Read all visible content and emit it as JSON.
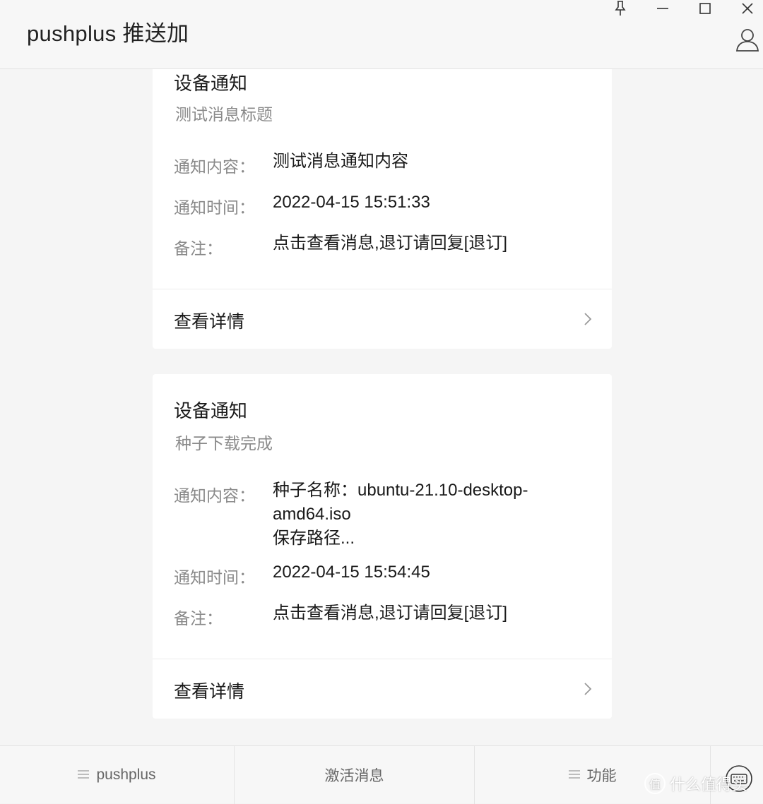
{
  "window": {
    "title": "pushplus 推送加",
    "icons": {
      "pin": "pin-icon",
      "minimize": "minimize-icon",
      "maximize": "maximize-icon",
      "close": "close-icon",
      "user": "user-icon"
    }
  },
  "cards": [
    {
      "title": "设备通知",
      "subtitle": "测试消息标题",
      "rows": [
        {
          "label": "通知内容：",
          "value": "测试消息通知内容"
        },
        {
          "label": "通知时间：",
          "value": "2022-04-15 15:51:33"
        },
        {
          "label": "备注：",
          "value": "点击查看消息,退订请回复[退订]"
        }
      ],
      "detail_label": "查看详情"
    },
    {
      "title": "设备通知",
      "subtitle": "种子下载完成",
      "rows": [
        {
          "label": "通知内容：",
          "value_lines": [
            "种子名称：ubuntu-21.10-desktop-",
            "amd64.iso",
            "保存路径..."
          ]
        },
        {
          "label": "通知时间：",
          "value": "2022-04-15 15:54:45"
        },
        {
          "label": "备注：",
          "value": "点击查看消息,退订请回复[退订]"
        }
      ],
      "detail_label": "查看详情"
    }
  ],
  "footer": {
    "tabs": [
      {
        "label": "pushplus",
        "icon": "menu-icon"
      },
      {
        "label": "激活消息"
      },
      {
        "label": "功能",
        "icon": "menu-icon"
      }
    ],
    "keyboard_icon": "keyboard-icon",
    "watermark": {
      "badge": "值",
      "text": "什么值得买"
    }
  },
  "colors": {
    "background": "#f5f5f5",
    "card": "#ffffff",
    "secondary_text": "#8a8a8a",
    "primary_text": "#1a1a1a"
  }
}
